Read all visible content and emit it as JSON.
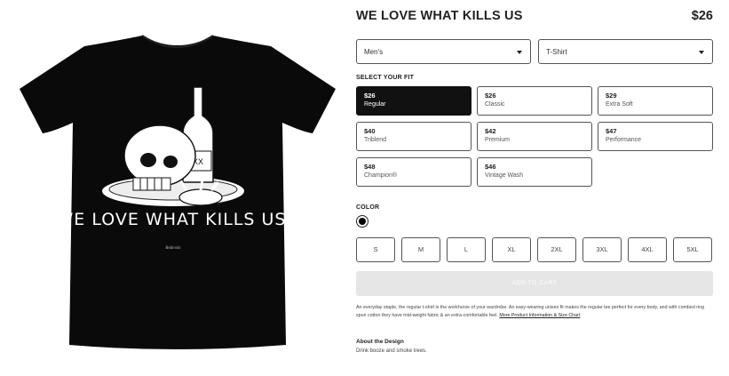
{
  "product": {
    "title": "WE LOVE WHAT KILLS US",
    "price": "$26",
    "artwork_text": "WE LOVE WHAT KILLS US",
    "signature": "Bebinski",
    "shirt_color": "#0a0a0a"
  },
  "selects": {
    "gender": "Men's",
    "type": "T-Shirt"
  },
  "fit": {
    "label": "SELECT YOUR FIT",
    "options": [
      {
        "price": "$26",
        "name": "Regular",
        "selected": true
      },
      {
        "price": "$26",
        "name": "Classic",
        "selected": false
      },
      {
        "price": "$29",
        "name": "Extra Soft",
        "selected": false
      },
      {
        "price": "$40",
        "name": "Triblend",
        "selected": false
      },
      {
        "price": "$42",
        "name": "Premium",
        "selected": false
      },
      {
        "price": "$47",
        "name": "Performance",
        "selected": false
      },
      {
        "price": "$48",
        "name": "Champion®",
        "selected": false
      },
      {
        "price": "$46",
        "name": "Vintage Wash",
        "selected": false
      }
    ]
  },
  "color": {
    "label": "COLOR",
    "selected": "#000000"
  },
  "sizes": [
    "S",
    "M",
    "L",
    "XL",
    "2XL",
    "3XL",
    "4XL",
    "5XL"
  ],
  "cart": {
    "label": "ADD TO CART"
  },
  "description": {
    "text": "An everyday staple, the regular t-shirt is the workhorse of your wardrobe. An easy-wearing unisex fit makes the regular tee perfect for every body, and with combed ring spun cotton they have mid-weight fabric & an extra-comfortable feel. ",
    "link": "More Product Information & Size Chart"
  },
  "about": {
    "title": "About the Design",
    "text": "Drink booze and smoke trees."
  }
}
